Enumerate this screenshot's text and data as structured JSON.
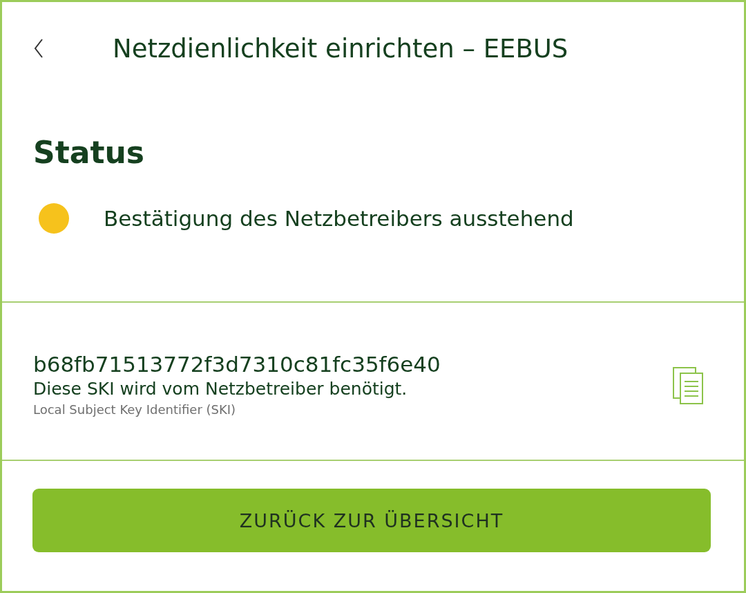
{
  "header": {
    "title": "Netzdienlichkeit einrichten – EEBUS"
  },
  "status": {
    "heading": "Status",
    "color": "#f6c21c",
    "text": "Bestätigung des Netzbetreibers ausstehend"
  },
  "ski": {
    "value": "b68fb71513772f3d7310c81fc35f6e40",
    "description": "Diese SKI wird vom Netzbetreiber benötigt.",
    "label": "Local Subject Key Identifier (SKI)"
  },
  "button": {
    "label": "ZURÜCK ZUR ÜBERSICHT"
  }
}
